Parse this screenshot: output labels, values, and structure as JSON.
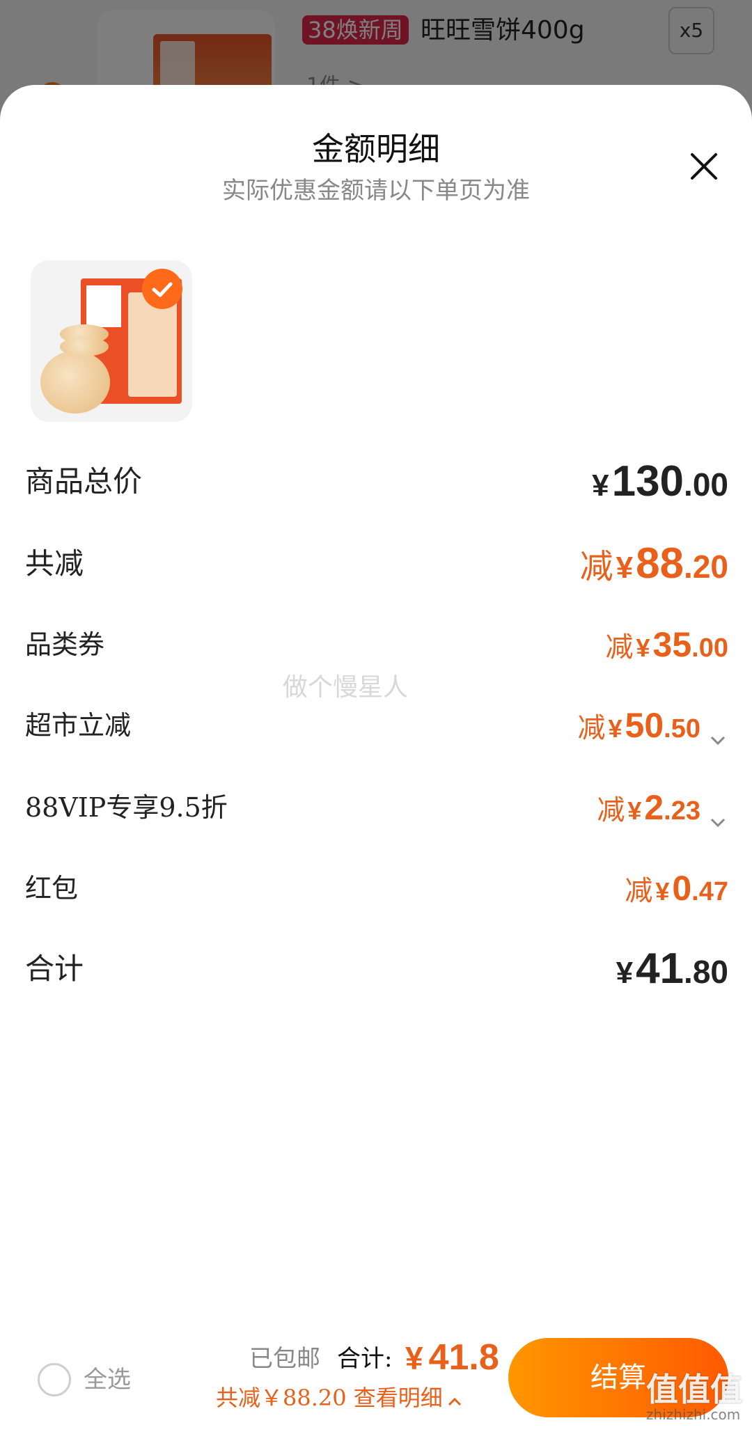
{
  "background_cart": {
    "promo_tag": "38焕新周",
    "product_name": "旺旺雪饼400g",
    "quantity": "x5",
    "count_text": "1件 >"
  },
  "sheet": {
    "title": "金额明细",
    "subtitle": "实际优惠金额请以下单页为准",
    "close_icon": "close-icon",
    "product_selected": true
  },
  "rows": [
    {
      "label": "商品总价",
      "prefix": "",
      "yen": "¥",
      "int": "130",
      "dec": ".00",
      "style": "big",
      "color": "black",
      "expand": false
    },
    {
      "label": "共减",
      "prefix": "减",
      "yen": "¥",
      "int": "88",
      "dec": ".20",
      "style": "big",
      "color": "orange",
      "expand": false
    },
    {
      "label": "品类券",
      "prefix": "减",
      "yen": "¥",
      "int": "35",
      "dec": ".00",
      "style": "small",
      "color": "orange",
      "expand": false
    },
    {
      "label": "超市立减",
      "prefix": "减",
      "yen": "¥",
      "int": "50",
      "dec": ".50",
      "style": "small",
      "color": "orange",
      "expand": true
    },
    {
      "label": "88VIP专享9.5折",
      "prefix": "减",
      "yen": "¥",
      "int": "2",
      "dec": ".23",
      "style": "small",
      "color": "orange",
      "expand": true
    },
    {
      "label": "红包",
      "prefix": "减",
      "yen": "¥",
      "int": "0",
      "dec": ".47",
      "style": "small",
      "color": "orange",
      "expand": false
    },
    {
      "label": "合计",
      "prefix": "",
      "yen": "¥",
      "int": "41",
      "dec": ".80",
      "style": "big",
      "color": "black",
      "expand": false
    }
  ],
  "watermark": "做个慢星人",
  "bottom_bar": {
    "select_all": "全选",
    "shipping": "已包邮",
    "total_label": "合计:",
    "total_yen": "¥",
    "total_value": "41.8",
    "saving_text": "共减￥88.20 查看明细",
    "checkout": "结算",
    "site_logo": "值值值",
    "site_url": "zhizhizhi.com"
  },
  "colors": {
    "accent": "#e8601a",
    "checkout_start": "#ff9600",
    "checkout_end": "#ff5a00"
  }
}
